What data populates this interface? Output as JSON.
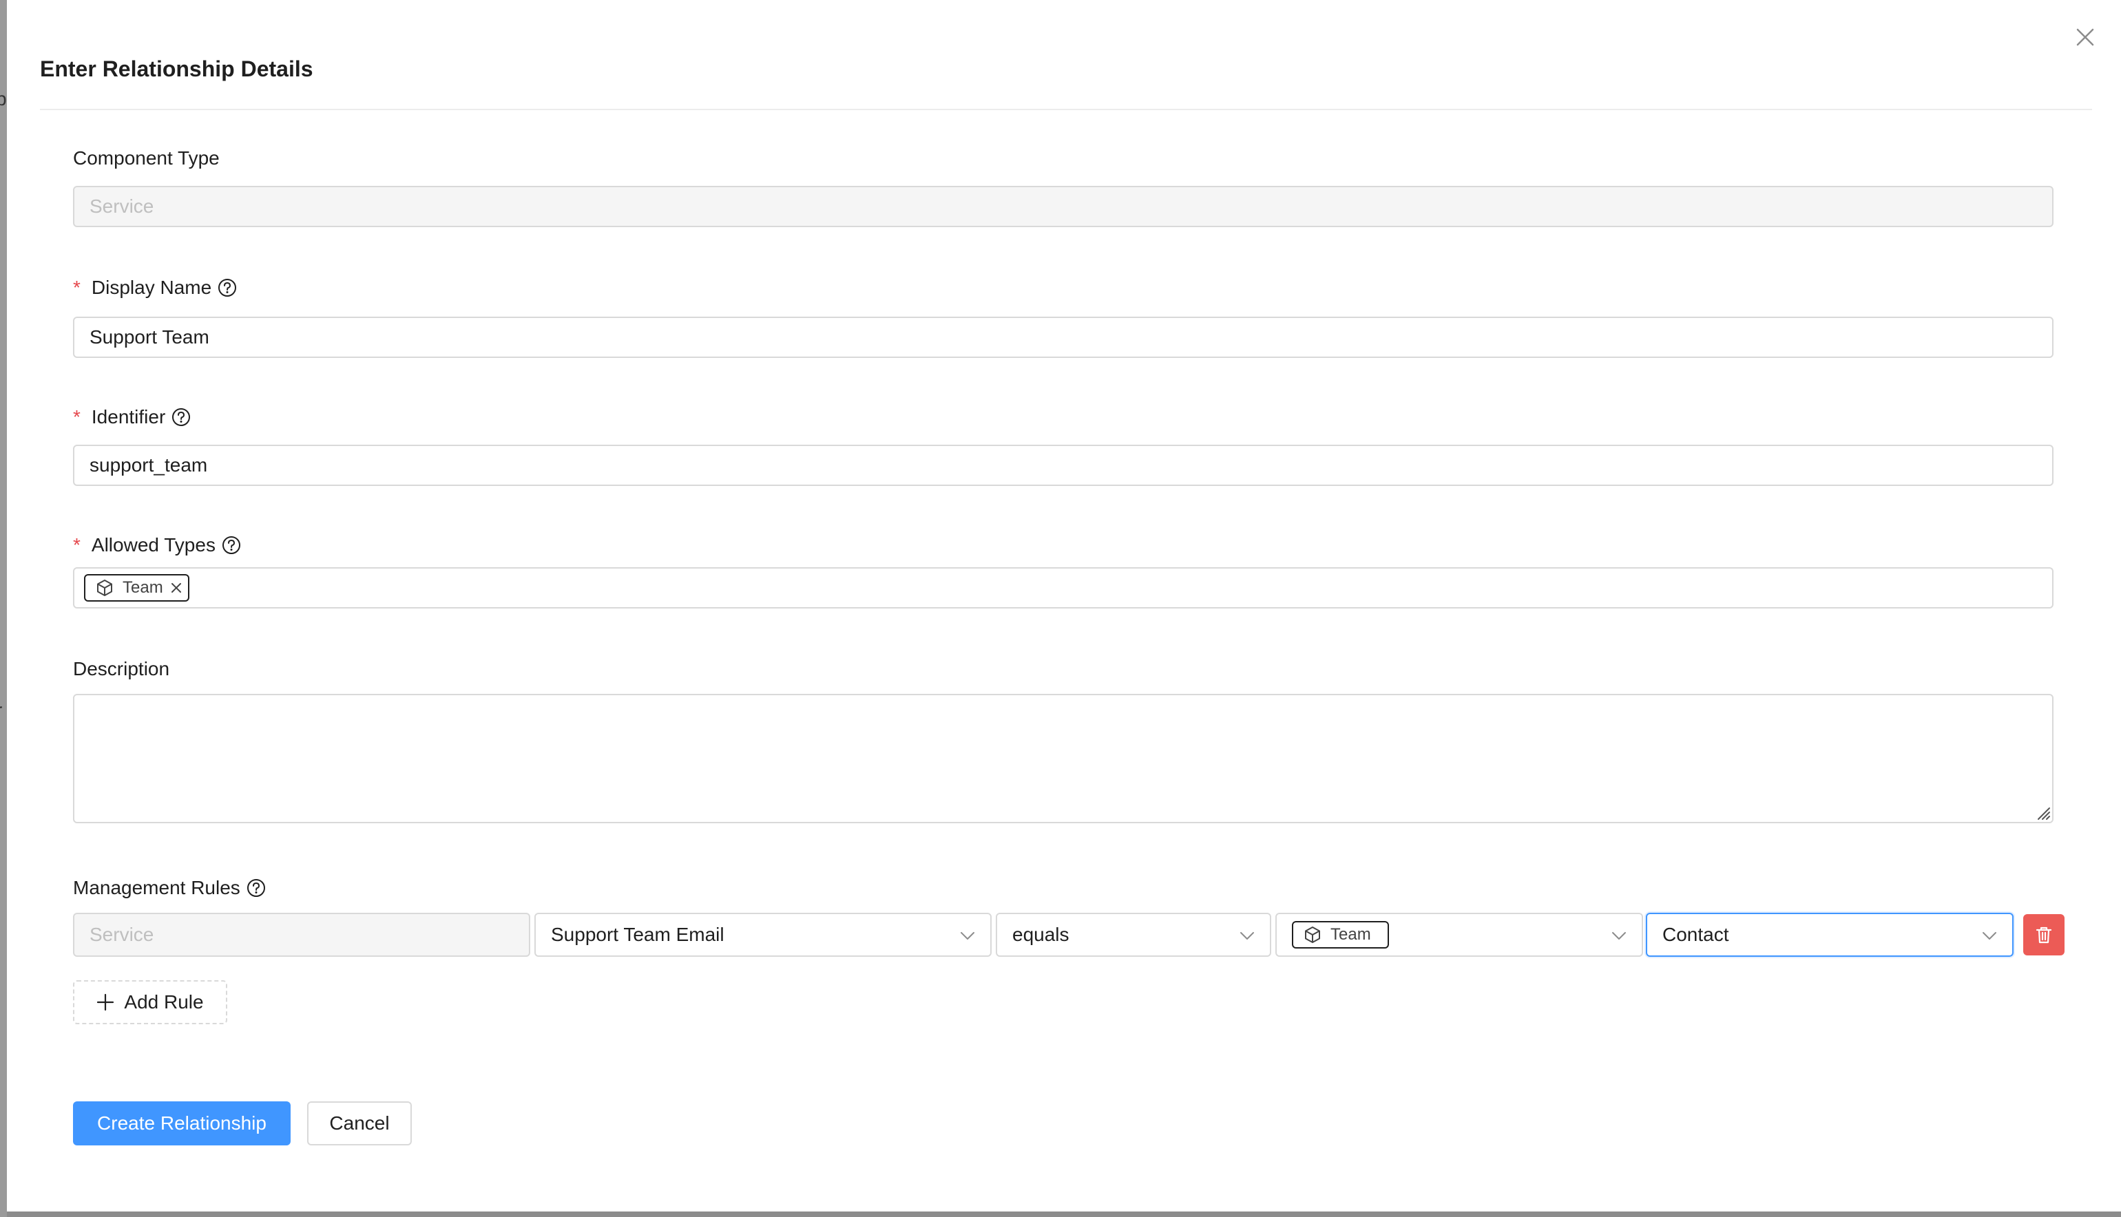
{
  "backdrop": {
    "fragment_1": "p",
    "fragment_2": "r"
  },
  "modal": {
    "title": "Enter Relationship Details",
    "close_icon": "close-icon"
  },
  "form": {
    "component_type": {
      "label": "Component Type",
      "value": "Service"
    },
    "display_name": {
      "label": "Display Name",
      "value": "Support Team",
      "required": true
    },
    "identifier": {
      "label": "Identifier",
      "value": "support_team",
      "required": true
    },
    "allowed_types": {
      "label": "Allowed Types",
      "required": true,
      "tags": [
        {
          "label": "Team",
          "icon": "cube-icon"
        }
      ]
    },
    "description": {
      "label": "Description",
      "value": ""
    },
    "management_rules": {
      "label": "Management Rules",
      "rules": [
        {
          "source": "Service",
          "property": "Support Team Email",
          "operator": "equals",
          "target_type_tag": "Team",
          "target_property": "Contact"
        }
      ],
      "add_rule_label": "Add Rule"
    }
  },
  "footer": {
    "create_label": "Create Relationship",
    "cancel_label": "Cancel"
  },
  "colors": {
    "primary": "#4096ff",
    "danger": "#ec5b56",
    "required": "#e5484d",
    "border": "#d9d9d9",
    "disabled_bg": "#f5f5f5"
  }
}
